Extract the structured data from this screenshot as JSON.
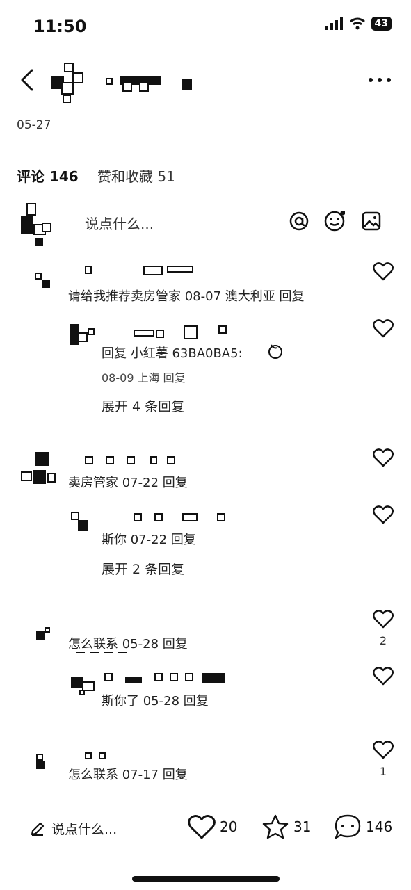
{
  "status_bar": {
    "time": "11:50",
    "battery": "43"
  },
  "header": {
    "date": "05-27"
  },
  "tabs": {
    "comments": "评论 146",
    "likes": "赞和收藏 51"
  },
  "compose": {
    "placeholder": "说点什么..."
  },
  "comments": [
    {
      "text": "请给我推荐卖房管家 08-07 澳大利亚 回复"
    },
    {
      "text": "回复 小红薯 63BA0BA5:",
      "meta": "08-09 上海 回复",
      "expand": "展开 4 条回复"
    },
    {
      "text": "卖房管家 07-22 回复"
    },
    {
      "text": "斯你 07-22 回复",
      "expand": "展开 2 条回复"
    },
    {
      "text": "怎么联系 05-28 回复",
      "likes": "2"
    },
    {
      "text": "斯你了 05-28 回复"
    },
    {
      "text": "怎么联系 07-17 回复",
      "likes": "1"
    }
  ],
  "bottom": {
    "placeholder": "说点什么...",
    "likes": "20",
    "stars": "31",
    "comments": "146"
  }
}
